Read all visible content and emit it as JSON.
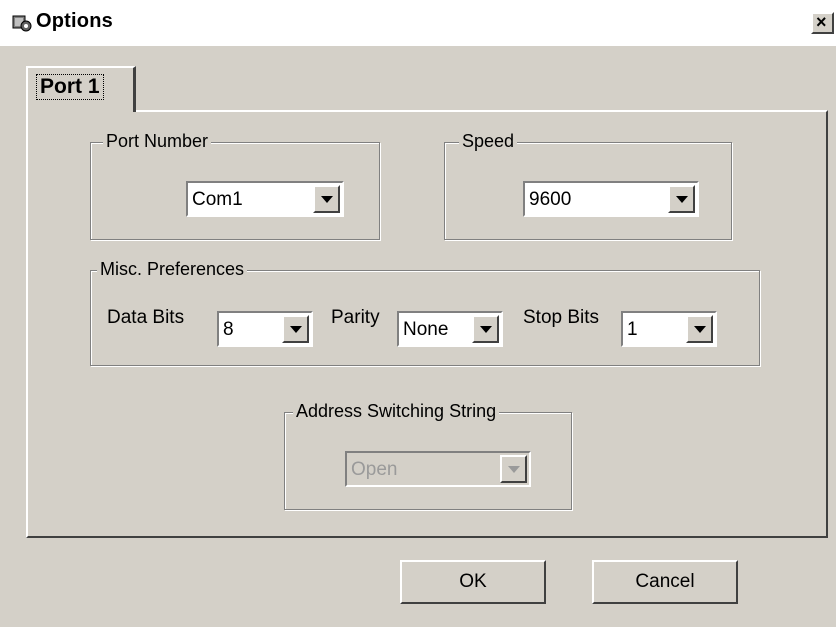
{
  "window": {
    "title": "Options",
    "close_glyph": "×"
  },
  "tabs": [
    {
      "label": "Port 1"
    }
  ],
  "port_number": {
    "legend": "Port Number",
    "value": "Com1"
  },
  "speed": {
    "legend": "Speed",
    "value": "9600"
  },
  "misc": {
    "legend": "Misc. Preferences",
    "data_bits": {
      "label": "Data Bits",
      "value": "8"
    },
    "parity": {
      "label": "Parity",
      "value": "None"
    },
    "stop_bits": {
      "label": "Stop Bits",
      "value": "1"
    }
  },
  "address_switching": {
    "legend": "Address Switching String",
    "value": "Open",
    "disabled": true
  },
  "buttons": {
    "ok": "OK",
    "cancel": "Cancel"
  },
  "icons": {
    "title": "app-icon",
    "close": "close-icon",
    "dropdown": "chevron-down-icon"
  },
  "colors": {
    "face": "#d4d0c8",
    "highlight": "#ffffff",
    "shadow": "#808080",
    "dark_shadow": "#404040",
    "disabled_text": "#9a9a9a"
  }
}
